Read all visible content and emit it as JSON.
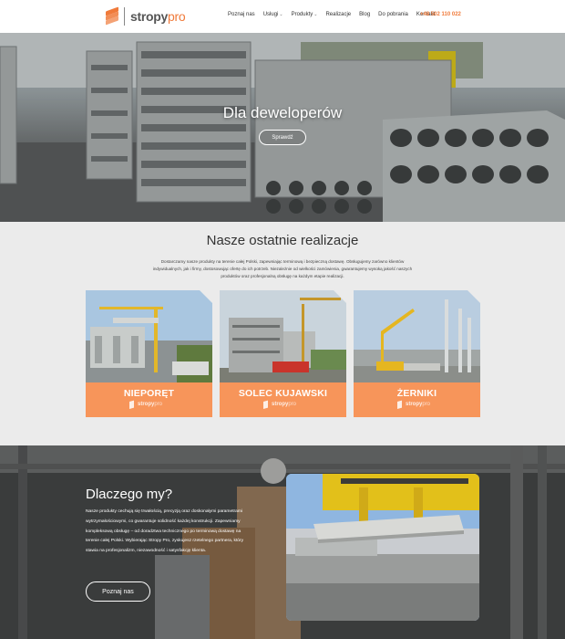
{
  "header": {
    "logo_text_a": "stropy",
    "logo_text_b": "pro",
    "nav": [
      {
        "label": "Poznaj nas",
        "caret": ""
      },
      {
        "label": "Usługi",
        "caret": "⌄"
      },
      {
        "label": "Produkty",
        "caret": "⌄"
      },
      {
        "label": "Realizacje",
        "caret": ""
      },
      {
        "label": "Blog",
        "caret": ""
      },
      {
        "label": "Do pobrania",
        "caret": ""
      },
      {
        "label": "Kontakt",
        "caret": ""
      }
    ],
    "phone": "+48 502 110 022"
  },
  "hero": {
    "title": "Dla deweloperów",
    "button": "Sprawdź"
  },
  "realizations": {
    "title": "Nasze ostatnie realizacje",
    "description": "Dostarczamy nasze produkty na terenie całej Polski, zapewniając terminową i bezpieczną dostawę. Obsługujemy zarówno klientów indywidualnych, jak i firmy, dostosowując ofertę do ich potrzeb. Niezależnie od wielkości zamówienia, gwarantujemy wysoką jakość naszych produktów oraz profesjonalną obsługę na każdym etapie realizacji.",
    "cards": [
      {
        "name": "NIEPORĘT",
        "brand_a": "stropy",
        "brand_b": "pro"
      },
      {
        "name": "SOLEC KUJAWSKI",
        "brand_a": "stropy",
        "brand_b": "pro"
      },
      {
        "name": "ŻERNIKI",
        "brand_a": "stropy",
        "brand_b": "pro"
      }
    ]
  },
  "why": {
    "title": "Dlaczego my?",
    "text": "Nasze produkty cechują się trwałością, precyzją oraz doskonałymi parametrami wytrzymałościowymi, co gwarantuje solidność każdej konstrukcji. Zapewniamy kompleksową obsługę – od doradztwa technicznego po terminową dostawę na terenie całej Polski. Wybierając Stropy Pro, zyskujesz rzetelnego partnera, który stawia na profesjonalizm, niezawodność i satysfakcję klienta.",
    "button": "Poznaj nas"
  },
  "colors": {
    "accent": "#f07a3a",
    "card_band": "#f7955a",
    "section_bg": "#ebebeb"
  }
}
